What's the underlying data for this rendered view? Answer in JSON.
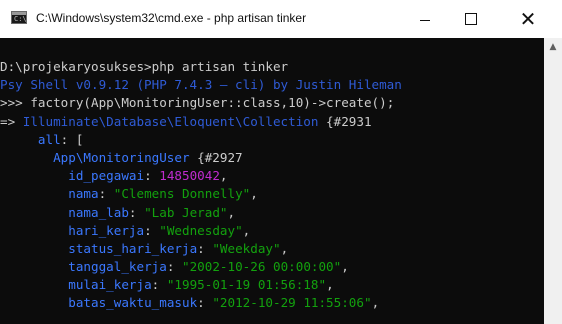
{
  "window": {
    "title": "C:\\Windows\\system32\\cmd.exe - php  artisan tinker",
    "icon": "cmd-icon",
    "controls": {
      "minimize": "minimize-icon",
      "maximize": "maximize-icon",
      "close": "close-icon"
    }
  },
  "colors": {
    "background": "#0c0c0c",
    "text": "#cccccc",
    "green": "#13a10e",
    "blue": "#3b78ff",
    "magenta": "#c02bd0"
  },
  "console": {
    "prompt": "D:\\projekaryosukses>php artisan tinker",
    "psysh_banner": "Psy Shell v0.9.12 (PHP 7.4.3 — cli) by Justin Hileman",
    "input_prefix": ">>> ",
    "input": "factory(App\\MonitoringUser::class,10)->create();",
    "result_arrow": "=> ",
    "result_class": "Illuminate\\Database\\Eloquent\\Collection",
    "result_id": " {#2931",
    "all_key": "all",
    "all_open": ": [",
    "model_class": "App\\MonitoringUser",
    "model_id": " {#2927",
    "fields": [
      {
        "key": "id_pegawai",
        "value": "14850042",
        "kind": "number"
      },
      {
        "key": "nama",
        "value": "\"Clemens Donnelly\"",
        "kind": "string"
      },
      {
        "key": "nama_lab",
        "value": "\"Lab Jerad\"",
        "kind": "string"
      },
      {
        "key": "hari_kerja",
        "value": "\"Wednesday\"",
        "kind": "string"
      },
      {
        "key": "status_hari_kerja",
        "value": "\"Weekday\"",
        "kind": "string"
      },
      {
        "key": "tanggal_kerja",
        "value": "\"2002-10-26 00:00:00\"",
        "kind": "string"
      },
      {
        "key": "mulai_kerja",
        "value": "\"1995-01-19 01:56:18\"",
        "kind": "string"
      },
      {
        "key": "batas_waktu_masuk",
        "value": "\"2012-10-29 11:55:06\"",
        "kind": "string"
      }
    ]
  }
}
